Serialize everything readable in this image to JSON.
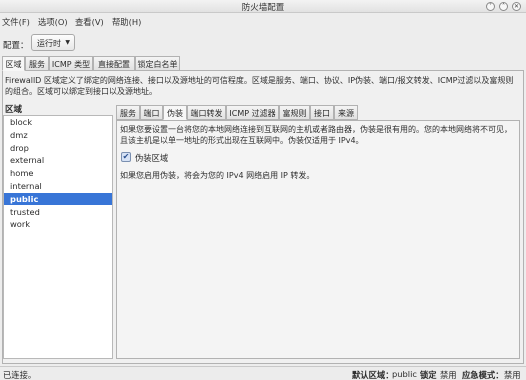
{
  "window": {
    "title": "防火墙配置"
  },
  "menu": {
    "file": "文件(F)",
    "options": "选项(O)",
    "view": "查看(V)",
    "help": "帮助(H)"
  },
  "config": {
    "label": "配置：",
    "value": "运行时"
  },
  "top_tabs": [
    "区域",
    "服务",
    "ICMP 类型",
    "直接配置",
    "锁定白名单"
  ],
  "description": "FirewallD 区域定义了绑定的网络连接、接口以及源地址的可信程度。区域是服务、端口、协议、IP伪装、端口/报文转发、ICMP过滤以及富规则的组合。区域可以绑定到接口以及源地址。",
  "zone_section": {
    "header": "区域",
    "zones": [
      "block",
      "dmz",
      "drop",
      "external",
      "home",
      "internal",
      "public",
      "trusted",
      "work"
    ],
    "selected": "public"
  },
  "inner_tabs": [
    "服务",
    "端口",
    "伪装",
    "端口转发",
    "ICMP 过滤器",
    "富规则",
    "接口",
    "来源"
  ],
  "masquerade": {
    "description": "如果您要设置一台将您的本地网络连接到互联网的主机或者路由器，伪装是很有用的。您的本地网络将不可见，且该主机是以单一地址的形式出现在互联网中。伪装仅适用于 IPv4。",
    "checkbox_label": "伪装区域",
    "checked": true,
    "note": "如果您启用伪装，将会为您的 IPv4 网络启用 IP 转发。"
  },
  "status": {
    "connection": "已连接。",
    "default_zone_label": "默认区域：",
    "default_zone_value": "public",
    "lockdown_label": "锁定",
    "lockdown_value": "禁用",
    "panic_label": "应急模式：",
    "panic_value": "禁用"
  },
  "colors": {
    "selection": "#3875d7",
    "background": "#ededed"
  }
}
